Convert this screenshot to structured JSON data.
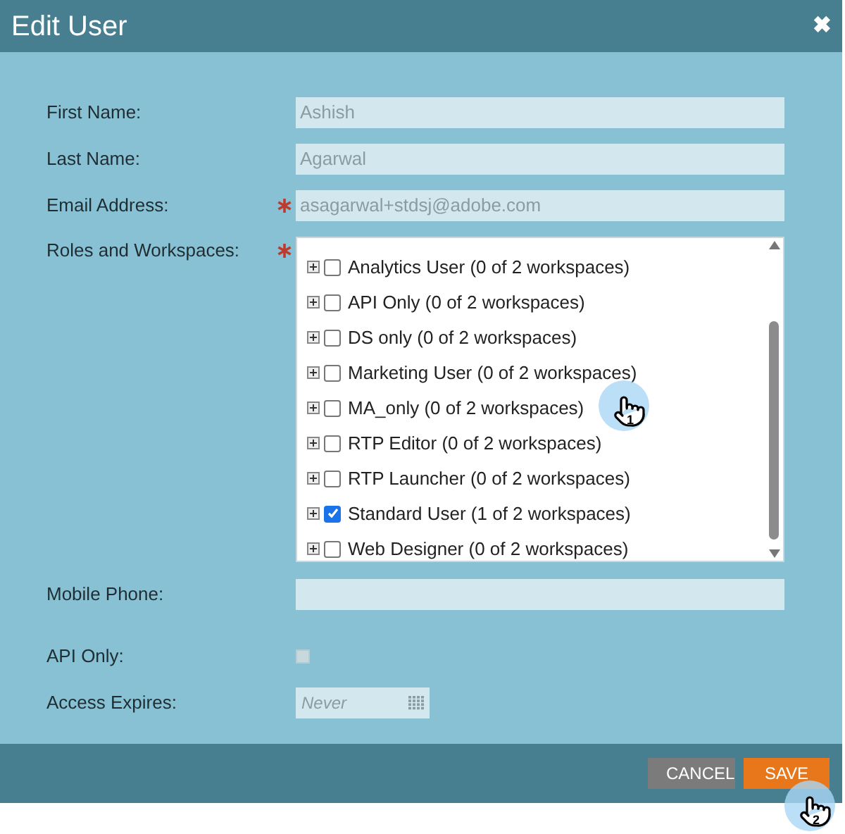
{
  "window": {
    "title": "Edit User",
    "close": "✖"
  },
  "fields": [
    {
      "label": "First Name:",
      "value": "Ashish",
      "required": false
    },
    {
      "label": "Last Name:",
      "value": "Agarwal",
      "required": false
    },
    {
      "label": "Email Address:",
      "value": "asagarwal+stdsj@adobe.com",
      "required": true
    }
  ],
  "roles": {
    "label": "Roles and Workspaces:",
    "required": true,
    "items": [
      {
        "label": "Analytics User (0 of 2 workspaces)",
        "checked": false
      },
      {
        "label": "API Only (0 of 2 workspaces)",
        "checked": false
      },
      {
        "label": "DS only (0 of 2 workspaces)",
        "checked": false
      },
      {
        "label": "Marketing User (0 of 2 workspaces)",
        "checked": false
      },
      {
        "label": "MA_only (0 of 2 workspaces)",
        "checked": false
      },
      {
        "label": "RTP Editor (0 of 2 workspaces)",
        "checked": false
      },
      {
        "label": "RTP Launcher (0 of 2 workspaces)",
        "checked": false
      },
      {
        "label": "Standard User (1 of 2 workspaces)",
        "checked": true
      },
      {
        "label": "Web Designer (0 of 2 workspaces)",
        "checked": false
      }
    ]
  },
  "mobile_phone": {
    "label": "Mobile Phone:"
  },
  "api_only": {
    "label": "API Only:",
    "checked": false,
    "disabled": true
  },
  "access_expires": {
    "label": "Access Expires:",
    "placeholder": "Never"
  },
  "buttons": [
    {
      "label": "CANCEL",
      "kind": "secondary"
    },
    {
      "label": "SAVE",
      "kind": "primary"
    }
  ],
  "step_markers": [
    "1",
    "2"
  ]
}
